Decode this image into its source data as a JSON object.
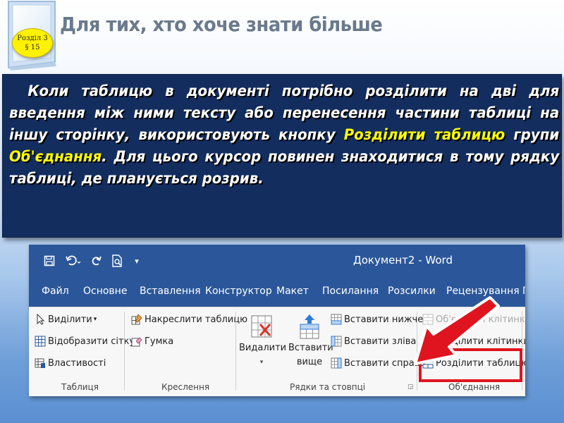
{
  "slide": {
    "badge_line1": "Розділ 3",
    "badge_line2": "§ 15",
    "title": "Для тих, хто хоче знати більше",
    "body_part1": "Коли таблицю в документі потрібно розділити на дві для введення між ними тексту або перенесення частини таблиці на іншу сторінку, використовують кнопку ",
    "body_hl1": "Розділити таблицю",
    "body_part2": " групи ",
    "body_hl2": "Об'єднання",
    "body_part3": ". Для цього курсор повинен знаходитися в тому рядку таблиці, де планується розрив."
  },
  "word": {
    "doc_title": "Документ2 - Word",
    "tabs": [
      "Файл",
      "Основне",
      "Вставлення",
      "Конструктор",
      "Макет",
      "Посилання",
      "Розсилки",
      "Рецензування",
      "Г"
    ],
    "groups": {
      "table": {
        "label": "Таблиця",
        "items": [
          "Виділити",
          "Відобразити сітку",
          "Властивості"
        ]
      },
      "draw": {
        "label": "Креслення",
        "items": [
          "Накреслити таблицю",
          "Гумка"
        ]
      },
      "rows_cols": {
        "label": "Рядки та стовпці",
        "delete_label": "Видалити",
        "insert_above_line1": "Вставити",
        "insert_above_line2": "вище",
        "items": [
          "Вставити нижче",
          "Вставити зліва",
          "Вставити справа"
        ]
      },
      "merge": {
        "label": "Об'єднання",
        "items": [
          "Об'єднати клітинки",
          "Розділити клітинки",
          "Розділити таблицю"
        ]
      }
    }
  },
  "colors": {
    "textbox_bg": "#132d5f",
    "highlight_text": "#ffff00",
    "word_blue": "#2b579a",
    "callout_red": "#e0141e"
  }
}
